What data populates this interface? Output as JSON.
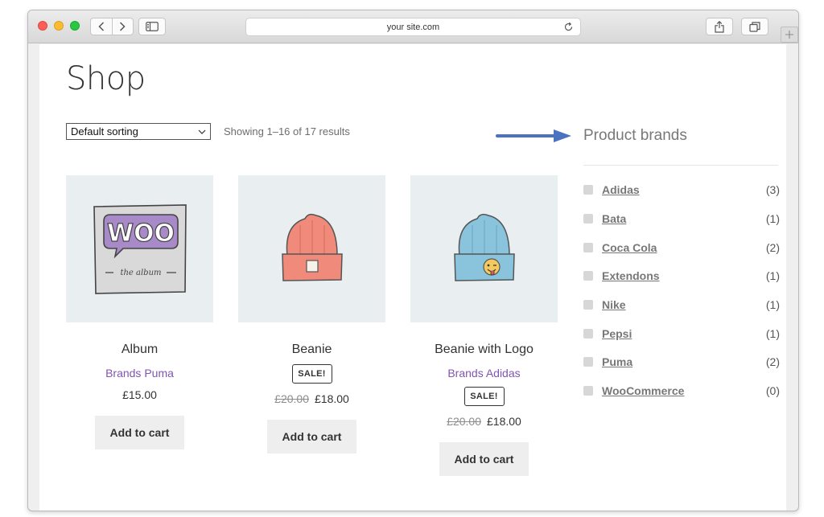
{
  "browser": {
    "url": "your site.com"
  },
  "shop": {
    "title": "Shop",
    "sort_selected": "Default sorting",
    "result_count": "Showing 1–16 of 17 results"
  },
  "products": [
    {
      "title": "Album",
      "brand": "Brands Puma",
      "sale": "",
      "price_old": "",
      "price": "£15.00",
      "cart_label": "Add to cart"
    },
    {
      "title": "Beanie",
      "brand": "",
      "sale": "SALE!",
      "price_old": "£20.00",
      "price": "£18.00",
      "cart_label": "Add to cart"
    },
    {
      "title": "Beanie with Logo",
      "brand": "Brands Adidas",
      "sale": "SALE!",
      "price_old": "£20.00",
      "price": "£18.00",
      "cart_label": "Add to cart"
    }
  ],
  "album_art": {
    "logo_text": "WOO",
    "caption": "the album"
  },
  "sidebar": {
    "title": "Product brands",
    "brands": [
      {
        "name": "Adidas",
        "count": "(3)"
      },
      {
        "name": "Bata",
        "count": "(1)"
      },
      {
        "name": "Coca Cola",
        "count": "(2)"
      },
      {
        "name": "Extendons",
        "count": "(1)"
      },
      {
        "name": "Nike",
        "count": "(1)"
      },
      {
        "name": "Pepsi",
        "count": "(1)"
      },
      {
        "name": "Puma",
        "count": "(2)"
      },
      {
        "name": "WooCommerce",
        "count": "(0)"
      }
    ]
  },
  "colors": {
    "brand_link": "#7f54b3",
    "annotation_arrow": "#4a72c0",
    "beanie_orange": "#f08a7a",
    "beanie_blue": "#8ac4dc"
  }
}
